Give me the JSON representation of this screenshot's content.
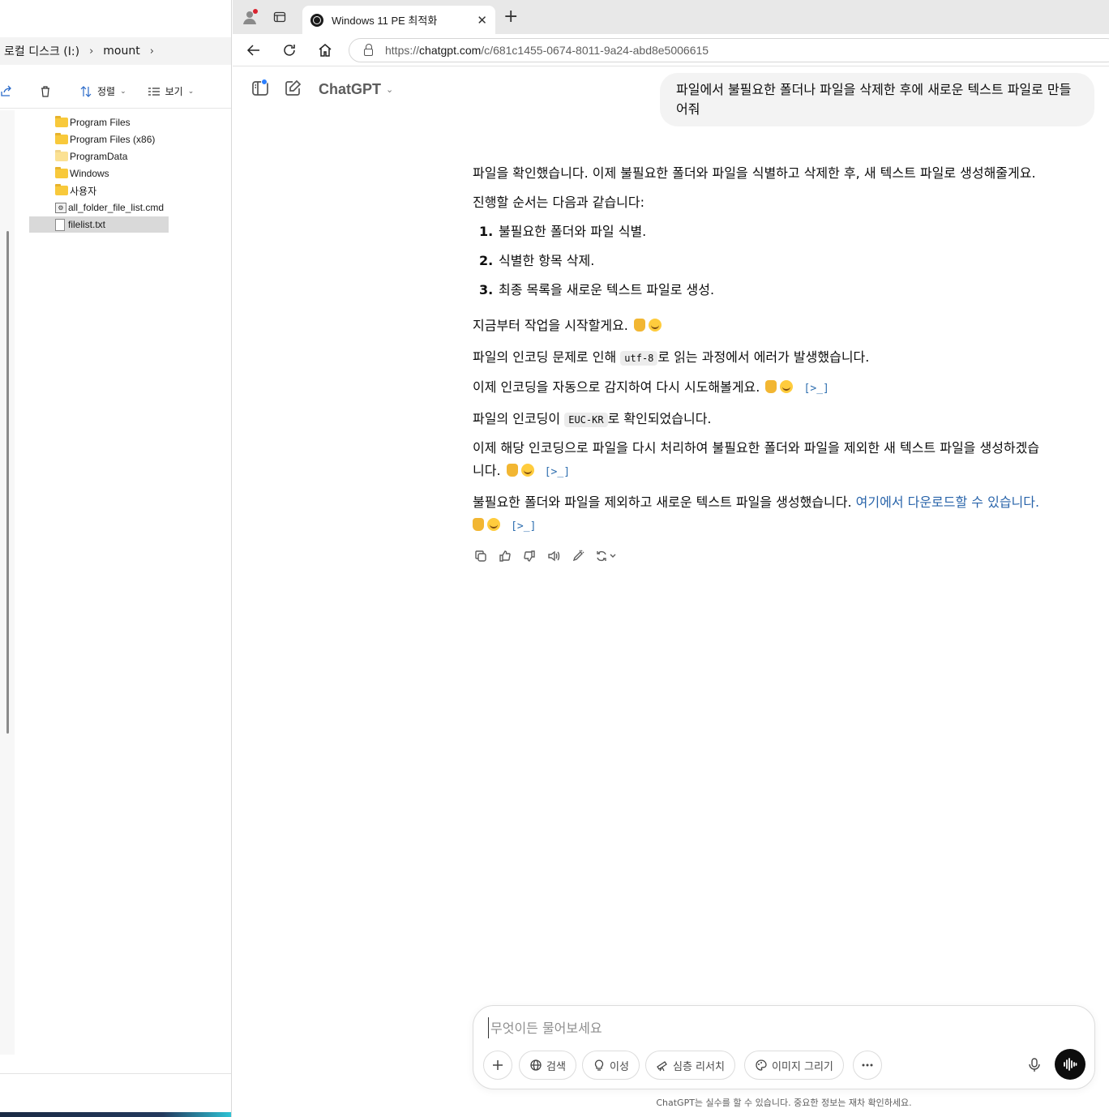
{
  "explorer": {
    "breadcrumb": [
      "로컬 디스크 (I:)",
      "mount"
    ],
    "toolbar": {
      "sort_label": "정렬",
      "view_label": "보기"
    },
    "tree": [
      {
        "label": "Program Files",
        "kind": "folder"
      },
      {
        "label": "Program Files (x86)",
        "kind": "folder"
      },
      {
        "label": "ProgramData",
        "kind": "folder"
      },
      {
        "label": "Windows",
        "kind": "folder"
      },
      {
        "label": "사용자",
        "kind": "folder"
      },
      {
        "label": "all_folder_file_list.cmd",
        "kind": "cmd"
      },
      {
        "label": "filelist.txt",
        "kind": "file",
        "selected": true
      }
    ]
  },
  "browser": {
    "tab": {
      "title": "Windows 11 PE 최적화"
    },
    "address": {
      "scheme": "https://",
      "host": "chatgpt.com",
      "path": "/c/681c1455-0674-8011-9a24-abd8e5006615"
    }
  },
  "chat": {
    "model_name": "ChatGPT",
    "user_message": "파일에서 불필요한 폴더나 파일을 삭제한 후에 새로운 텍스트 파일로 만들어줘",
    "assistant": {
      "intro": "파일을 확인했습니다. 이제 불필요한 폴더와 파일을 식별하고 삭제한 후, 새 텍스트 파일로 생성해줄게요.",
      "steps_intro": "진행할 순서는 다음과 같습니다:",
      "steps": [
        {
          "num": "1.",
          "text": "불필요한 폴더와 파일 식별."
        },
        {
          "num": "2.",
          "text": "식별한 항목 삭제."
        },
        {
          "num": "3.",
          "text": "최종 목록을 새로운 텍스트 파일로 생성."
        }
      ],
      "start": "지금부터 작업을 시작할게요.",
      "encoding_error_pre": "파일의 인코딩 문제로 인해 ",
      "encoding_error_code": "utf-8",
      "encoding_error_post": "로 읽는 과정에서 에러가 발생했습니다.",
      "auto_detect": "이제 인코딩을 자동으로 감지하여 다시 시도해볼게요.",
      "detected_pre": "파일의 인코딩이 ",
      "detected_code": "EUC-KR",
      "detected_post": "로 확인되었습니다.",
      "process_line1": "이제 해당 인코딩으로 파일을 다시 처리하여 불필요한 폴더와 파일을 제외한 새 텍스트 파일을 생성하겠습",
      "process_line2": "니다.",
      "done_text": "불필요한 폴더와 파일을 제외하고 새로운 텍스트 파일을 생성했습니다. ",
      "done_link": "여기에서 다운로드할 수 있습니다.",
      "code_ref_glyph": "[>_]"
    },
    "composer": {
      "placeholder": "무엇이든 물어보세요",
      "search_label": "검색",
      "reason_label": "이성",
      "research_label": "심층 리서치",
      "image_label": "이미지 그리기"
    },
    "disclaimer": "ChatGPT는 실수를 할 수 있습니다. 중요한 정보는 재차 확인하세요."
  },
  "colors": {
    "link": "#2964aa",
    "accent_dot": "#2b7fff",
    "user_bubble": "#f3f3f3",
    "folder": "#f8c93b"
  }
}
